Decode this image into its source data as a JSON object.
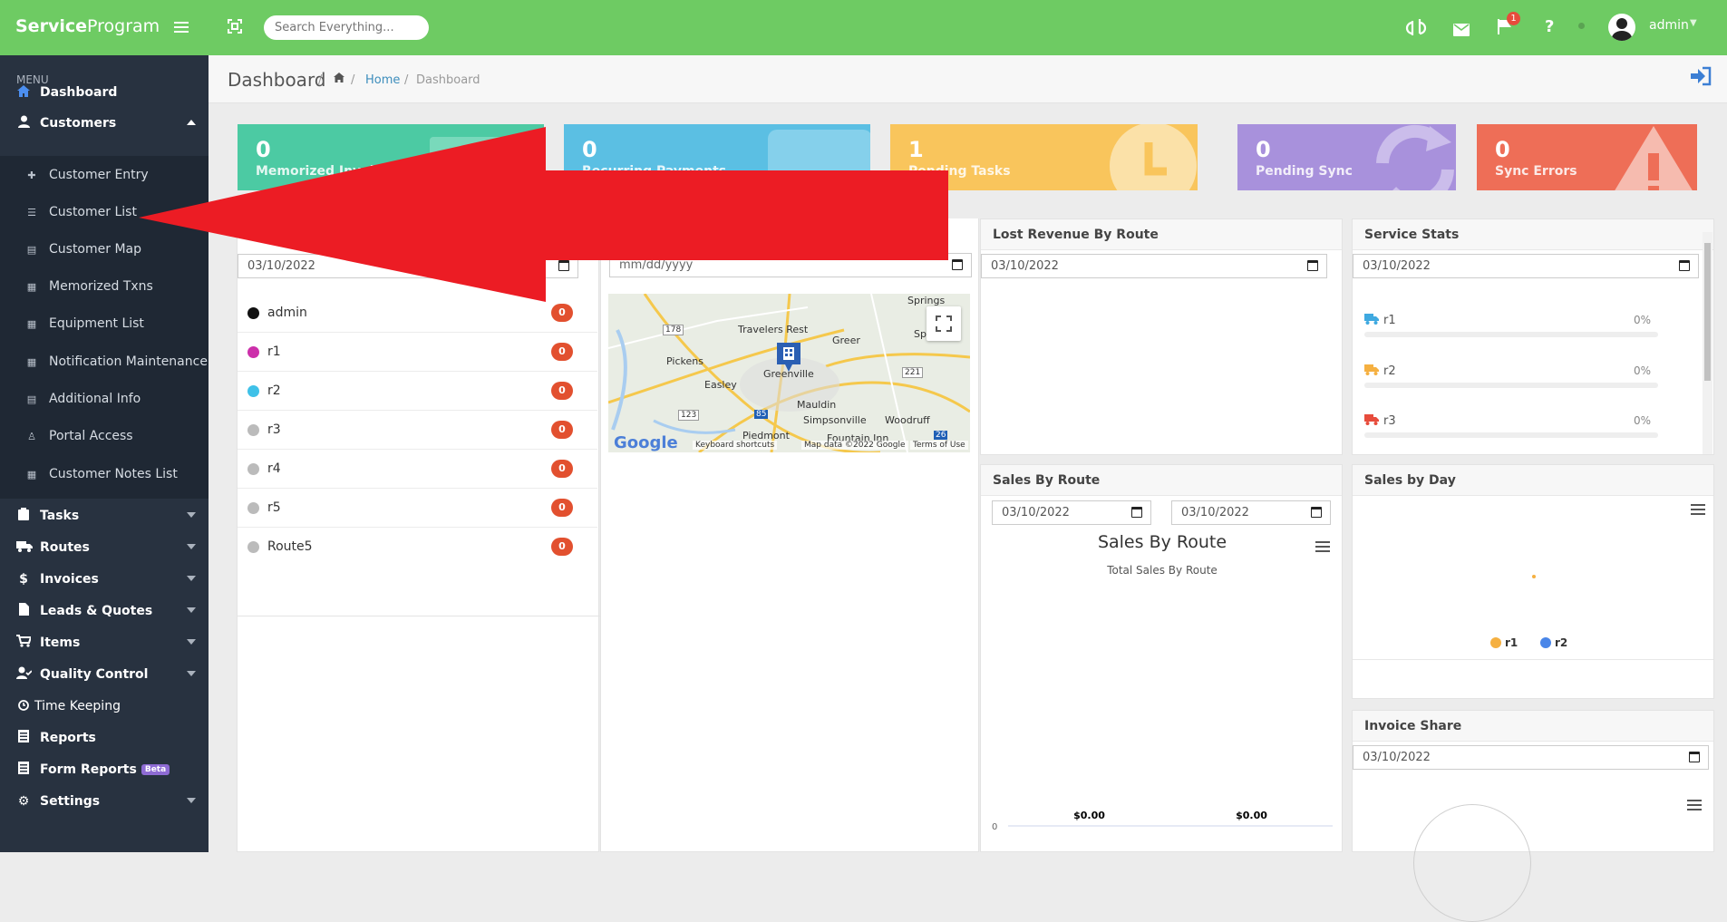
{
  "topbar": {
    "brand_bold": "Service",
    "brand_rest": "Program",
    "search_placeholder": "Search Everything...",
    "notification_count": "1",
    "user_name": "admin",
    "accent_color": "#6ecb63"
  },
  "sidebar": {
    "menu_label": "MENU",
    "items": [
      {
        "label": "Dashboard",
        "icon": "home-icon"
      },
      {
        "label": "Customers",
        "icon": "user-icon",
        "expanded": true
      },
      {
        "label": "Tasks",
        "icon": "clipboard-icon"
      },
      {
        "label": "Routes",
        "icon": "truck-icon"
      },
      {
        "label": "Invoices",
        "icon": "dollar-icon"
      },
      {
        "label": "Leads & Quotes",
        "icon": "file-icon"
      },
      {
        "label": "Items",
        "icon": "cart-icon"
      },
      {
        "label": "Quality Control",
        "icon": "user-check-icon"
      },
      {
        "label": "Time Keeping",
        "icon": "alarm-clock-icon"
      },
      {
        "label": "Reports",
        "icon": "report-icon"
      },
      {
        "label": "Form Reports",
        "icon": "report-icon",
        "badge": "Beta"
      },
      {
        "label": "Settings",
        "icon": "gear-icon"
      }
    ],
    "customers_submenu": [
      {
        "label": "Customer Entry",
        "icon": "plus-icon"
      },
      {
        "label": "Customer List",
        "icon": "list-icon"
      },
      {
        "label": "Customer Map",
        "icon": "map-icon"
      },
      {
        "label": "Memorized Txns",
        "icon": "calendar-icon"
      },
      {
        "label": "Equipment List",
        "icon": "table-icon"
      },
      {
        "label": "Notification Maintenance",
        "icon": "table-icon"
      },
      {
        "label": "Additional Info",
        "icon": "list-icon"
      },
      {
        "label": "Portal Access",
        "icon": "user-lock-icon"
      },
      {
        "label": "Customer Notes List",
        "icon": "table-icon"
      }
    ]
  },
  "breadcrumb": {
    "title": "Dashboard",
    "home": "Home",
    "current": "Dashboard"
  },
  "cards": [
    {
      "value": "0",
      "label": "Memorized Invoices",
      "color": "#4ccaa3"
    },
    {
      "value": "0",
      "label": "Recurring Payments",
      "color": "#5bbfe3"
    },
    {
      "value": "1",
      "label": "Pending Tasks",
      "color": "#f9c55c"
    },
    {
      "value": "0",
      "label": "Pending Sync",
      "color": "#a891dc"
    },
    {
      "value": "0",
      "label": "Sync Errors",
      "color": "#ee6e57"
    }
  ],
  "routes_panel": {
    "date": "03/10/2022",
    "routes": [
      {
        "name": "admin",
        "count": "0",
        "color": "#111111"
      },
      {
        "name": "r1",
        "count": "0",
        "color": "#cc2faa"
      },
      {
        "name": "r2",
        "count": "0",
        "color": "#3fc1e8"
      },
      {
        "name": "r3",
        "count": "0",
        "color": "#bbbbbb"
      },
      {
        "name": "r4",
        "count": "0",
        "color": "#bbbbbb"
      },
      {
        "name": "r5",
        "count": "0",
        "color": "#bbbbbb"
      },
      {
        "name": "Route5",
        "count": "0",
        "color": "#bbbbbb"
      }
    ]
  },
  "map_panel": {
    "date_placeholder": "mm/dd/yyyy",
    "places": [
      "Travelers Rest",
      "Greer",
      "Pickens",
      "Easley",
      "Greenville",
      "Mauldin",
      "Simpsonville",
      "Woodruff",
      "Piedmont",
      "Fountain Inn",
      "Springs",
      "Sp"
    ],
    "shields": [
      "178",
      "123",
      "85",
      "221",
      "26"
    ],
    "google": "Google",
    "footer": [
      "Keyboard shortcuts",
      "Map data ©2022 Google",
      "Terms of Use"
    ]
  },
  "lost_revenue": {
    "title": "Lost Revenue By Route",
    "date": "03/10/2022"
  },
  "service_stats": {
    "title": "Service Stats",
    "date": "03/10/2022",
    "rows": [
      {
        "name": "r1",
        "percent": "0%",
        "color": "#3fa9e0"
      },
      {
        "name": "r2",
        "percent": "0%",
        "color": "#f5b041"
      },
      {
        "name": "r3",
        "percent": "0%",
        "color": "#e74c3c"
      }
    ]
  },
  "sales_by_route": {
    "title": "Sales By Route",
    "date_from": "03/10/2022",
    "date_to": "03/10/2022"
  },
  "sales_by_day": {
    "title": "Sales by Day"
  },
  "invoice_share": {
    "title": "Invoice Share",
    "date": "03/10/2022"
  },
  "chart_data": [
    {
      "type": "bar",
      "title": "Sales By Route",
      "subtitle": "Total Sales By Route",
      "categories": [
        "",
        ""
      ],
      "values": [
        0,
        0
      ],
      "data_labels": [
        "$0.00",
        "$0.00"
      ],
      "y_tick_labels": [
        "0"
      ]
    },
    {
      "type": "scatter",
      "title": "",
      "series": [
        {
          "name": "r1",
          "color": "#f5b041",
          "values": [
            0
          ]
        },
        {
          "name": "r2",
          "color": "#4a86e8",
          "values": []
        }
      ],
      "legend": "bottom"
    }
  ]
}
